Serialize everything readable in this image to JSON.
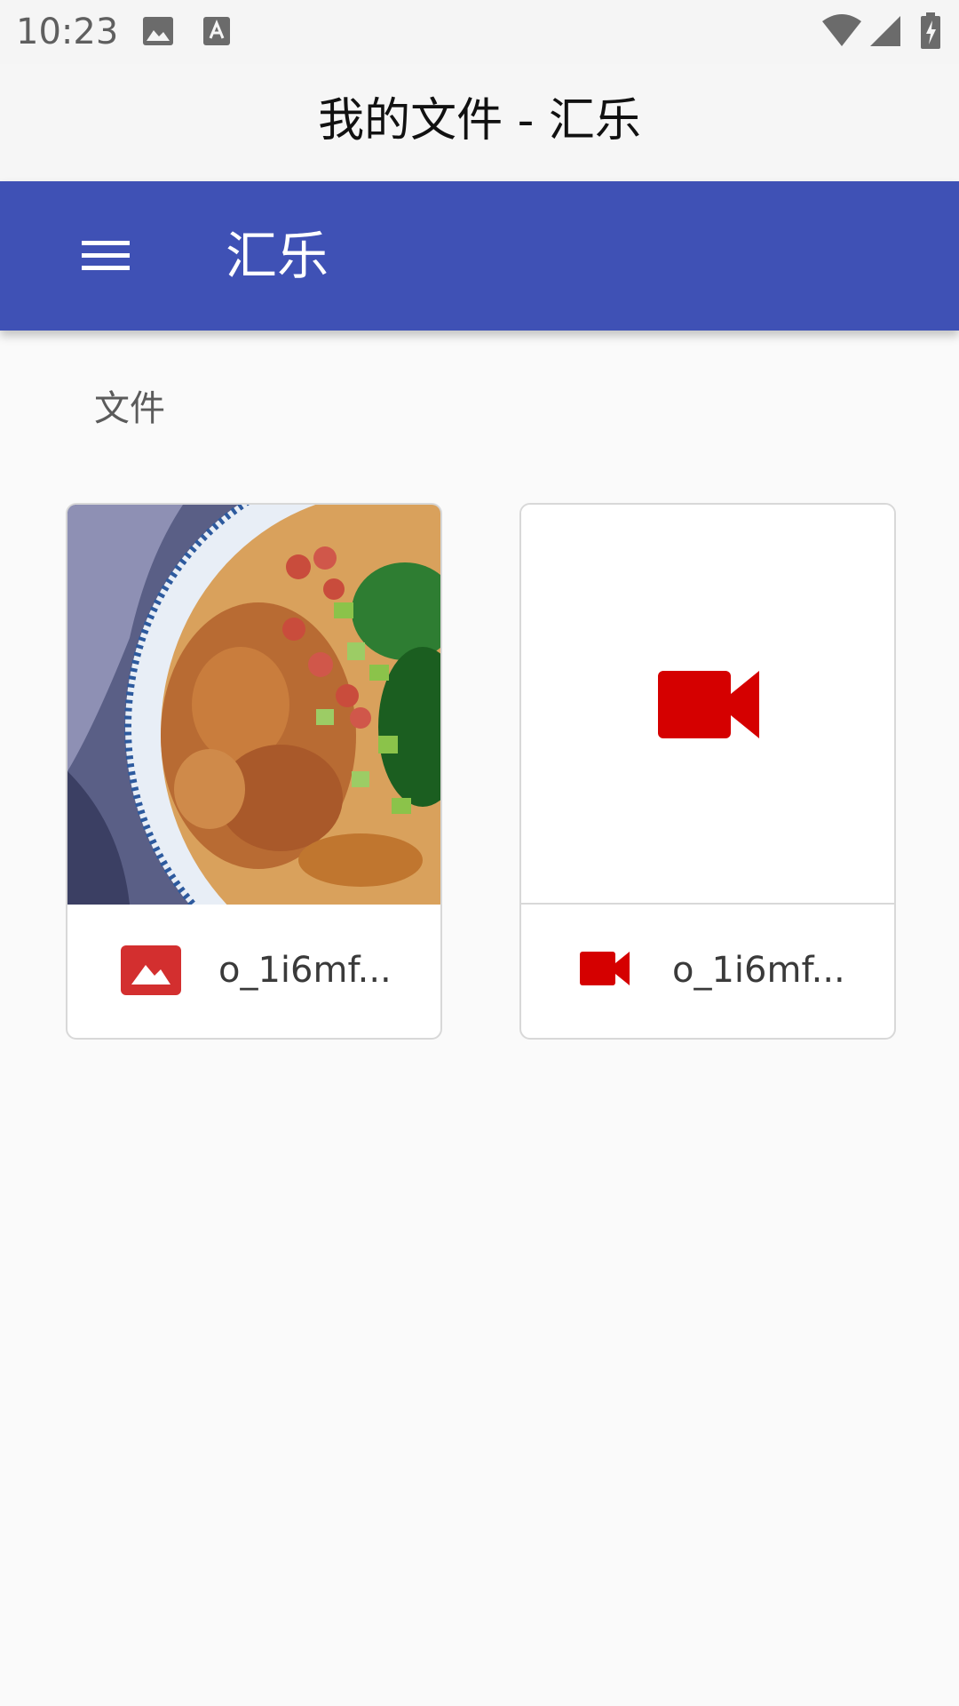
{
  "status_bar": {
    "time": "10:23",
    "left_icons": [
      "image-icon",
      "text-a-icon"
    ],
    "right_icons": [
      "wifi-icon",
      "cell-signal-icon",
      "battery-charging-icon"
    ]
  },
  "window": {
    "title": "我的文件 - 汇乐"
  },
  "app_bar": {
    "menu_icon": "menu-icon",
    "title": "汇乐",
    "color": "#3f51b5"
  },
  "section": {
    "label": "文件"
  },
  "files": [
    {
      "type": "image",
      "thumbnail": "food-photo",
      "type_icon": "image-file-icon",
      "type_icon_color": "#d32f2f",
      "name": "o_1i6mf..."
    },
    {
      "type": "video",
      "thumbnail": "video-placeholder",
      "type_icon": "video-camera-icon",
      "type_icon_color": "#d50000",
      "name": "o_1i6mf..."
    }
  ]
}
